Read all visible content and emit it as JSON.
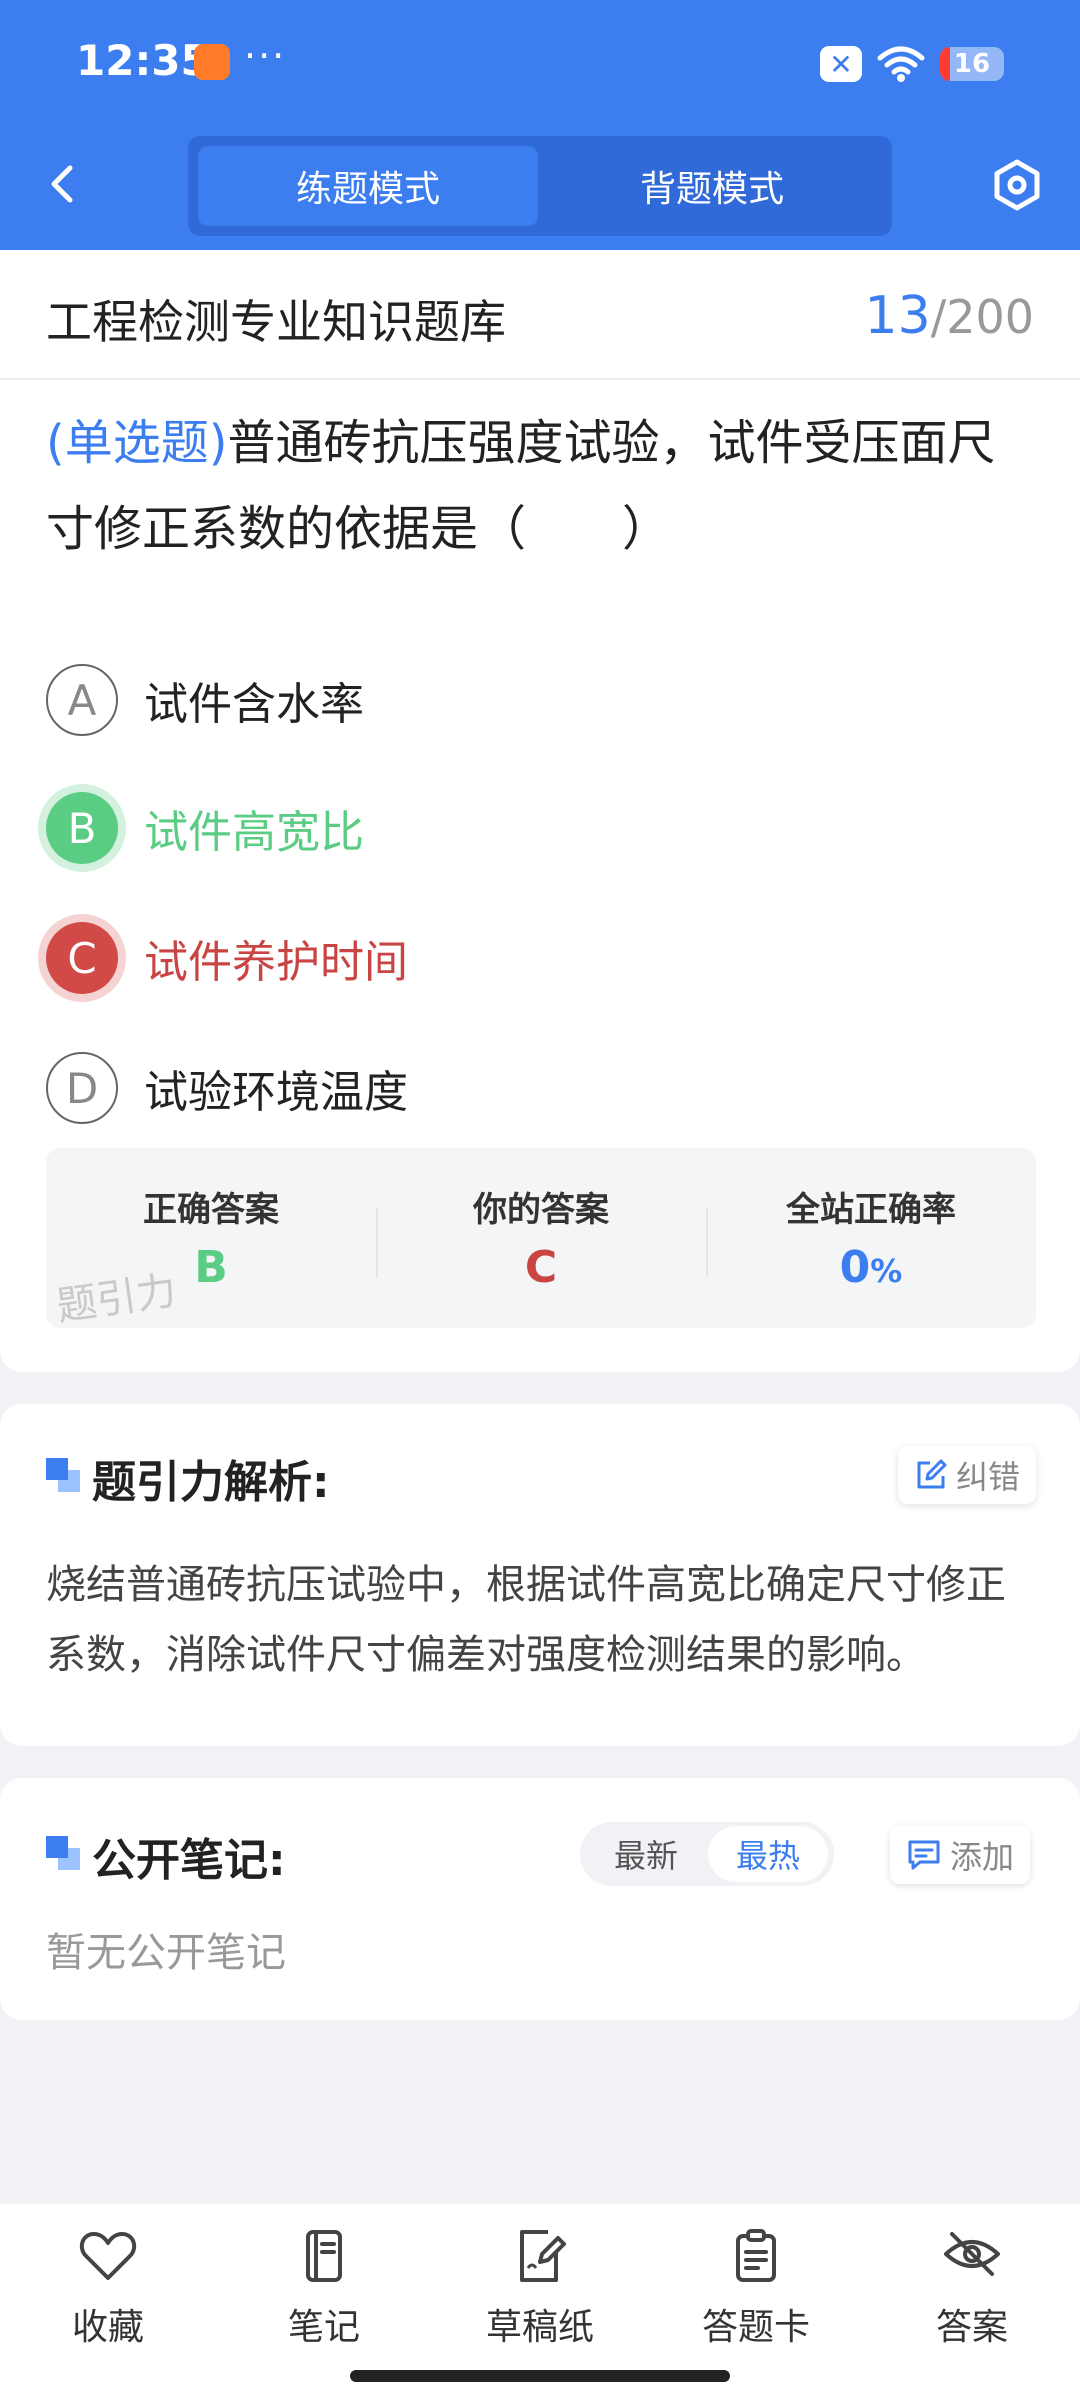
{
  "status_bar": {
    "time": "12:35",
    "dots": "···",
    "battery": "16"
  },
  "header": {
    "modes": [
      "练题模式",
      "背题模式"
    ],
    "active_mode": "练题模式",
    "accent_color": "#3c7df0"
  },
  "question": {
    "bank_title": "工程检测专业知识题库",
    "current": "13",
    "total_sep": "/",
    "total": "200",
    "type_label": "(单选题)",
    "text": "普通砖抗压强度试验，试件受压面尺寸修正系数的依据是（　　）",
    "options": [
      {
        "letter": "A",
        "text": "试件含水率",
        "state": "normal"
      },
      {
        "letter": "B",
        "text": "试件高宽比",
        "state": "correct"
      },
      {
        "letter": "C",
        "text": "试件养护时间",
        "state": "wrong"
      },
      {
        "letter": "D",
        "text": "试验环境温度",
        "state": "normal"
      }
    ]
  },
  "answer_summary": {
    "correct_label": "正确答案",
    "correct_value": "B",
    "yours_label": "你的答案",
    "yours_value": "C",
    "rate_label": "全站正确率",
    "rate_value": "0",
    "rate_unit": "%",
    "watermark": "题引力",
    "colors": {
      "correct": "#5bcc83",
      "wrong": "#c84543",
      "rate": "#3c7df0"
    }
  },
  "analysis": {
    "title": "题引力解析:",
    "report_label": "纠错",
    "text": "烧结普通砖抗压试验中，根据试件高宽比确定尺寸修正系数，消除试件尺寸偏差对强度检测结果的影响。"
  },
  "notes": {
    "title": "公开笔记:",
    "sort_options": [
      "最新",
      "最热"
    ],
    "active_sort": "最热",
    "add_label": "添加",
    "empty_text": "暂无公开笔记"
  },
  "bottom_nav": [
    {
      "label": "收藏",
      "icon": "heart-icon"
    },
    {
      "label": "笔记",
      "icon": "notebook-icon"
    },
    {
      "label": "草稿纸",
      "icon": "draft-paper-icon"
    },
    {
      "label": "答题卡",
      "icon": "answer-sheet-icon"
    },
    {
      "label": "答案",
      "icon": "eye-off-icon"
    }
  ]
}
